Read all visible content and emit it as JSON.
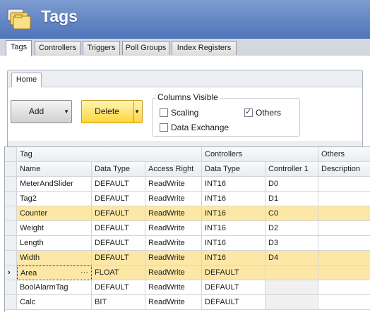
{
  "app": {
    "title": "Tags"
  },
  "tabs": [
    "Tags",
    "Controllers",
    "Triggers",
    "Poll Groups",
    "Index Registers"
  ],
  "ribbon": {
    "tab": "Home",
    "add_label": "Add",
    "delete_label": "Delete",
    "columns_visible": {
      "title": "Columns Visible",
      "scaling": {
        "label": "Scaling",
        "checked": false
      },
      "others": {
        "label": "Others",
        "checked": true
      },
      "data_exchange": {
        "label": "Data Exchange",
        "checked": false
      }
    }
  },
  "grid": {
    "group_headers": [
      "Tag",
      "Controllers",
      "Others"
    ],
    "columns": [
      "Name",
      "Data Type",
      "Access Right",
      "Data Type",
      "Controller 1",
      "Description"
    ],
    "rows": [
      {
        "name": "MeterAndSlider",
        "data_type": "DEFAULT",
        "access": "ReadWrite",
        "ctrl_type": "INT16",
        "controller1": "D0",
        "description": "",
        "highlight": false,
        "selected": false
      },
      {
        "name": "Tag2",
        "data_type": "DEFAULT",
        "access": "ReadWrite",
        "ctrl_type": "INT16",
        "controller1": "D1",
        "description": "",
        "highlight": false,
        "selected": false
      },
      {
        "name": "Counter",
        "data_type": "DEFAULT",
        "access": "ReadWrite",
        "ctrl_type": "INT16",
        "controller1": "C0",
        "description": "",
        "highlight": true,
        "selected": false
      },
      {
        "name": "Weight",
        "data_type": "DEFAULT",
        "access": "ReadWrite",
        "ctrl_type": "INT16",
        "controller1": "D2",
        "description": "",
        "highlight": false,
        "selected": false
      },
      {
        "name": "Length",
        "data_type": "DEFAULT",
        "access": "ReadWrite",
        "ctrl_type": "INT16",
        "controller1": "D3",
        "description": "",
        "highlight": false,
        "selected": false
      },
      {
        "name": "Width",
        "data_type": "DEFAULT",
        "access": "ReadWrite",
        "ctrl_type": "INT16",
        "controller1": "D4",
        "description": "",
        "highlight": true,
        "selected": false
      },
      {
        "name": "Area",
        "data_type": "FLOAT",
        "access": "ReadWrite",
        "ctrl_type": "DEFAULT",
        "controller1": "",
        "description": "",
        "highlight": true,
        "selected": true
      },
      {
        "name": "BoolAlarmTag",
        "data_type": "DEFAULT",
        "access": "ReadWrite",
        "ctrl_type": "DEFAULT",
        "controller1": "",
        "description": "",
        "highlight": false,
        "selected": false
      },
      {
        "name": "Calc",
        "data_type": "BIT",
        "access": "ReadWrite",
        "ctrl_type": "DEFAULT",
        "controller1": "",
        "description": "",
        "highlight": false,
        "selected": false
      }
    ]
  },
  "icons": {
    "logo": "tags-folder-icon",
    "row_indicator": "current-row-arrow-icon",
    "cell_editor": "ellipsis-icon"
  },
  "colors": {
    "header_blue": "#4f74b8",
    "highlight": "#fde7a6",
    "delete_button": "#ffd53d"
  }
}
